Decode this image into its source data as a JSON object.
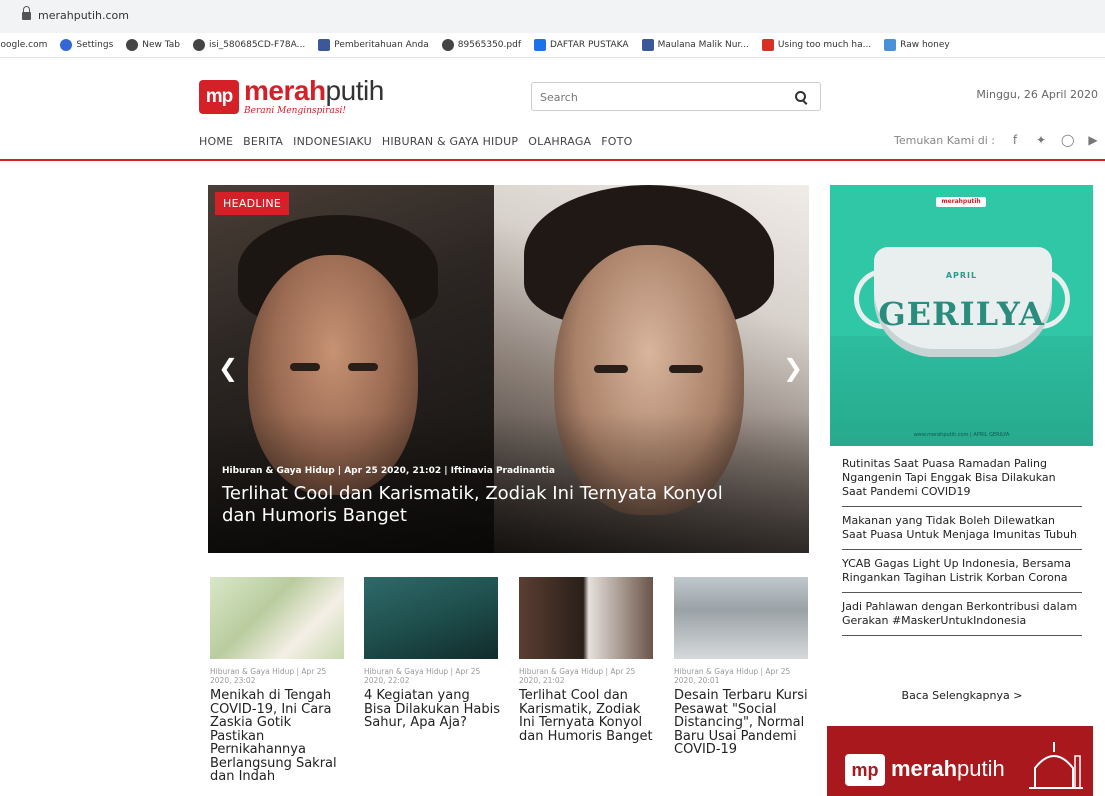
{
  "browser": {
    "url": "merahputih.com",
    "bookmarks": [
      {
        "label": "joogle.com",
        "icon": "none"
      },
      {
        "label": "Settings",
        "icon": "gear-icon"
      },
      {
        "label": "New Tab",
        "icon": "globe-icon"
      },
      {
        "label": "isi_580685CD-F78A...",
        "icon": "globe-icon"
      },
      {
        "label": "Pemberitahuan Anda",
        "icon": "facebook-icon"
      },
      {
        "label": "89565350.pdf",
        "icon": "globe-icon"
      },
      {
        "label": "DAFTAR PUSTAKA",
        "icon": "doc-icon"
      },
      {
        "label": "Maulana Malik Nur...",
        "icon": "facebook-icon"
      },
      {
        "label": "Using too much ha...",
        "icon": "red-icon"
      },
      {
        "label": "Raw honey",
        "icon": "blue-icon"
      }
    ]
  },
  "header": {
    "logo_badge": "mp",
    "logo_red": "merah",
    "logo_dark": "putih",
    "tagline": "Berani Menginspirasi!",
    "search_placeholder": "Search",
    "date": "Minggu, 26 April 2020",
    "nav": [
      "HOME",
      "BERITA",
      "INDONESIAKU",
      "HIBURAN & GAYA HIDUP",
      "OLAHRAGA",
      "FOTO"
    ],
    "follow_label": "Temukan Kami di :",
    "social": [
      "facebook-icon",
      "twitter-icon",
      "instagram-icon",
      "youtube-icon"
    ]
  },
  "hero": {
    "badge": "HEADLINE",
    "meta": "Hiburan & Gaya Hidup | Apr 25 2020, 21:02 | Iftinavia Pradinantia",
    "title": "Terlihat Cool dan Karismatik, Zodiak Ini Ternyata Konyol dan Humoris Banget"
  },
  "cards": [
    {
      "meta": "Hiburan & Gaya Hidup | Apr 25 2020, 23:02",
      "title": "Menikah di Tengah COVID-19, Ini Cara Zaskia Gotik Pastikan Pernikahannya Berlangsung Sakral dan Indah"
    },
    {
      "meta": "Hiburan & Gaya Hidup | Apr 25 2020, 22:02",
      "title": "4 Kegiatan yang Bisa Dilakukan Habis Sahur, Apa Aja?"
    },
    {
      "meta": "Hiburan & Gaya Hidup | Apr 25 2020, 21:02",
      "title": "Terlihat Cool dan Karismatik, Zodiak Ini Ternyata Konyol dan Humoris Banget"
    },
    {
      "meta": "Hiburan & Gaya Hidup | Apr 25 2020, 20:01",
      "title": "Desain Terbaru Kursi Pesawat \"Social Distancing\", Normal Baru Usai Pandemi COVID-19"
    }
  ],
  "sidebar": {
    "ad_logo": "merahputih",
    "ad_sub": "APRIL",
    "ad_word": "GERILYA",
    "ad_foot": "www.merahputih.com | APRIL GERILYA",
    "items": [
      "Rutinitas Saat Puasa Ramadan Paling Ngangenin Tapi Enggak Bisa Dilakukan Saat Pandemi COVID19",
      "Makanan yang Tidak Boleh Dilewatkan Saat Puasa Untuk Menjaga Imunitas Tubuh",
      "YCAB Gagas Light Up Indonesia, Bersama Ringankan Tagihan Listrik Korban Corona",
      "Jadi Pahlawan dengan Berkontribusi dalam Gerakan #MaskerUntukIndonesia"
    ],
    "more": "Baca Selengkapnya >",
    "ad2_badge": "mp",
    "ad2_red": "merah",
    "ad2_thin": "putih"
  },
  "colors": {
    "brand_red": "#d42027",
    "ad_teal": "#2fc7a6"
  }
}
